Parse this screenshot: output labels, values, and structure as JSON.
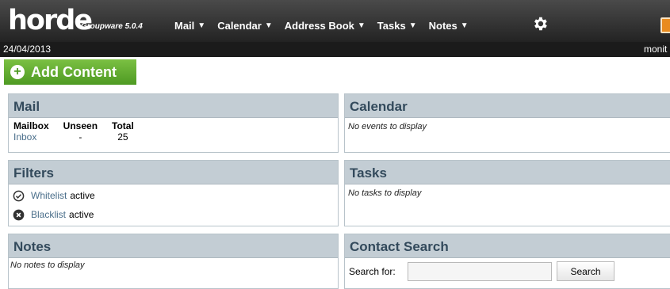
{
  "app": {
    "logo": "horde",
    "product": "Groupware 5.0.4",
    "date": "24/04/2013",
    "user": "monit"
  },
  "nav": {
    "items": [
      {
        "label": "Mail"
      },
      {
        "label": "Calendar"
      },
      {
        "label": "Address Book"
      },
      {
        "label": "Tasks"
      },
      {
        "label": "Notes"
      }
    ],
    "arrow": "▼",
    "settings_icon": "gear-icon"
  },
  "add_content": {
    "label": "Add Content",
    "icon": "plus-icon",
    "color": "#5fa830"
  },
  "blocks": {
    "mail": {
      "title": "Mail",
      "headers": [
        "Mailbox",
        "Unseen",
        "Total"
      ],
      "rows": [
        {
          "mailbox": "Inbox",
          "unseen": "-",
          "total": "25"
        }
      ]
    },
    "calendar": {
      "title": "Calendar",
      "empty": "No events to display"
    },
    "filters": {
      "title": "Filters",
      "items": [
        {
          "name": "Whitelist",
          "status": "active",
          "icon": "check-circle-icon"
        },
        {
          "name": "Blacklist",
          "status": "active",
          "icon": "x-circle-icon"
        }
      ]
    },
    "tasks": {
      "title": "Tasks",
      "empty": "No tasks to display"
    },
    "notes": {
      "title": "Notes",
      "empty": "No notes to display"
    },
    "contact_search": {
      "title": "Contact Search",
      "label": "Search for:",
      "value": "",
      "button": "Search"
    }
  },
  "colors": {
    "header_bg": "#2b2b2b",
    "block_header_bg": "#c3cdd4",
    "block_header_text": "#334a5c",
    "link": "#4a6e8a"
  }
}
